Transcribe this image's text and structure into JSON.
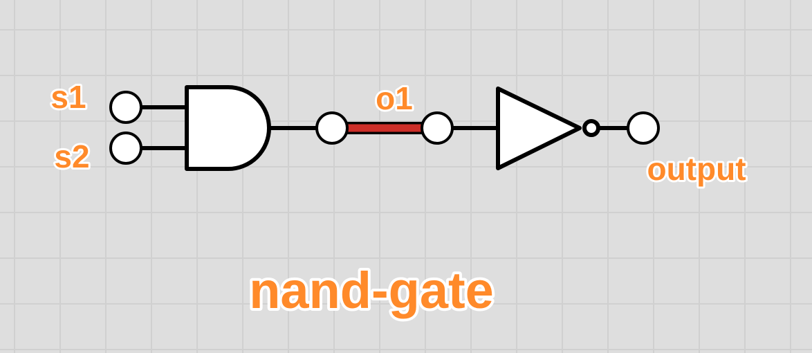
{
  "diagram": {
    "title": "nand-gate",
    "inputs": [
      {
        "id": "s1",
        "label": "s1"
      },
      {
        "id": "s2",
        "label": "s2"
      }
    ],
    "wire": {
      "id": "o1",
      "label": "o1"
    },
    "output": {
      "id": "output",
      "label": "output"
    },
    "gates": [
      "and-gate",
      "not-gate"
    ],
    "colors": {
      "label": "#ff8a2a",
      "label_outline": "#ffffff",
      "wire_active": "#cc2e28",
      "line": "#000000",
      "fill": "#ffffff",
      "grid_background": "#dedede",
      "grid_line": "#d0d0d0"
    }
  }
}
